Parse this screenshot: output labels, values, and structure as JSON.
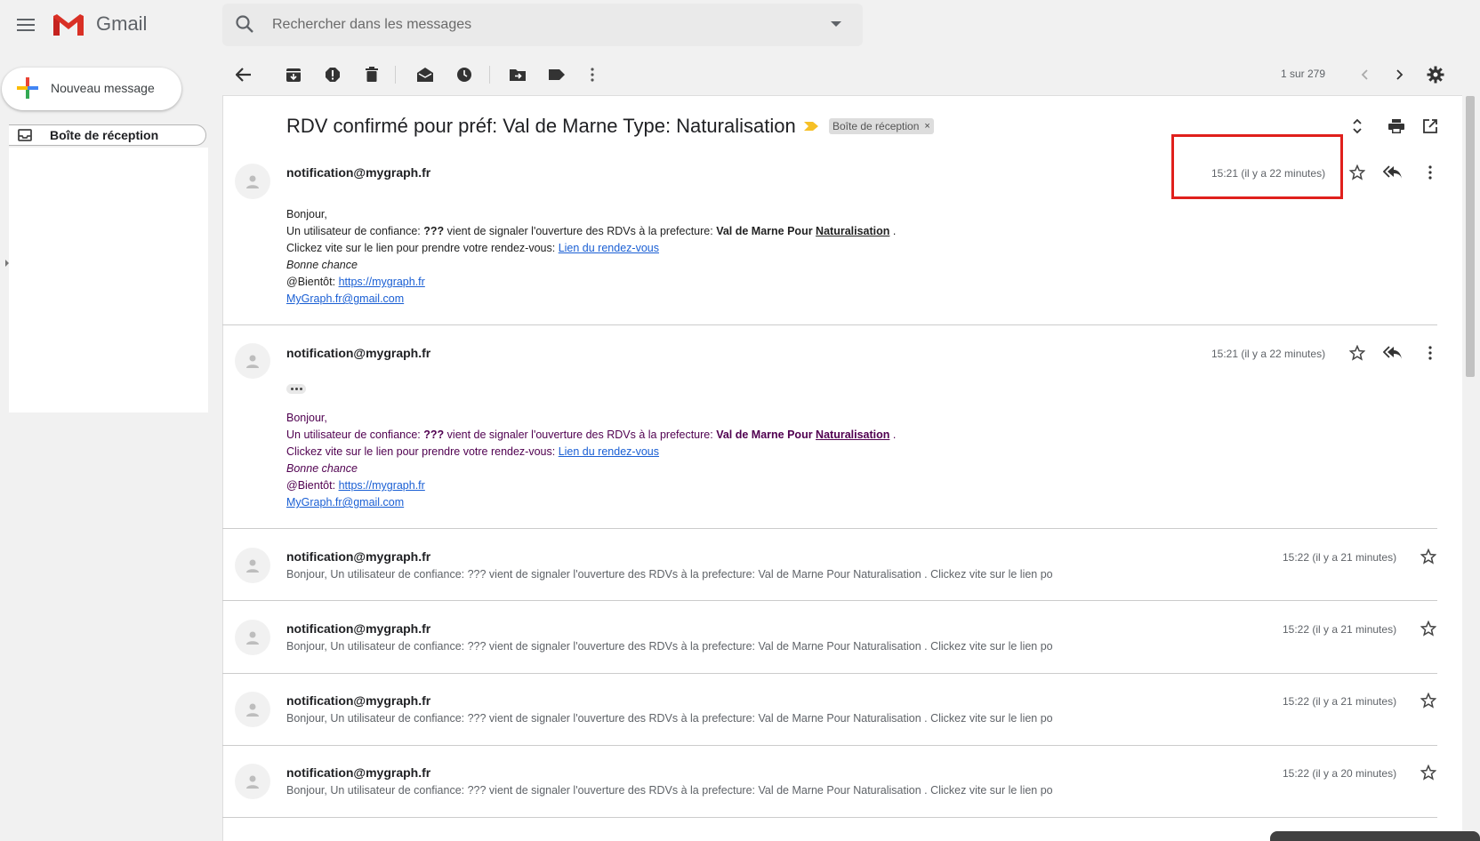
{
  "app": {
    "name": "Gmail",
    "menu_icon": "hamburger-menu-icon",
    "logo_icon": "gmail-m-logo"
  },
  "search": {
    "placeholder": "Rechercher dans les messages",
    "icon": "search-icon",
    "options_icon": "caret-down-icon"
  },
  "sidebar": {
    "compose_label": "Nouveau message",
    "inbox_label": "Boîte de réception"
  },
  "toolbar": {
    "pager": "1 sur 279",
    "icons": [
      "back-arrow-icon",
      "archive-icon",
      "report-spam-icon",
      "delete-icon",
      "mark-unread-icon",
      "snooze-icon",
      "move-to-icon",
      "label-icon",
      "more-vertical-icon",
      "older-chevron-icon",
      "newer-chevron-icon",
      "settings-gear-icon"
    ]
  },
  "thread": {
    "subject": "RDV confirmé pour préf: Val de Marne Type: Naturalisation",
    "label_chip": "Boîte de réception",
    "label_chip_close": "×"
  },
  "messages_expanded": [
    {
      "sender": "notification@mygraph.fr",
      "time": "15:21 (il y a 22 minutes)",
      "greeting": "Bonjour,",
      "line1_prefix": "Un utilisateur de confiance: ",
      "line1_bold1": "???",
      "line1_mid": " vient de signaler l'ouverture des RDVs à la prefecture: ",
      "line1_bold2": "Val de Marne Pour ",
      "line1_bold3": "Naturalisation",
      "line1_end": " .",
      "line2_prefix": "Clickez vite sur le lien pour prendre votre rendez-vous: ",
      "line2_link": "Lien du rendez-vous",
      "line3": "Bonne chance",
      "line4_prefix": "@Bientôt: ",
      "line4_link": "https://mygraph.fr",
      "line5_link": "MyGraph.fr@gmail.com"
    },
    {
      "sender": "notification@mygraph.fr",
      "time": "15:21 (il y a 22 minutes)",
      "greeting": "Bonjour,",
      "line1_prefix": "Un utilisateur de confiance: ",
      "line1_bold1": "???",
      "line1_mid": " vient de signaler l'ouverture des RDVs à la prefecture: ",
      "line1_bold2": "Val de Marne Pour ",
      "line1_bold3": "Naturalisation",
      "line1_end": " .",
      "line2_prefix": "Clickez vite sur le lien pour prendre votre rendez-vous: ",
      "line2_link": "Lien du rendez-vous",
      "line3": "Bonne chance",
      "line4_prefix": "@Bientôt: ",
      "line4_link": "https://mygraph.fr",
      "line5_link": "MyGraph.fr@gmail.com"
    }
  ],
  "messages_collapsed": [
    {
      "sender": "notification@mygraph.fr",
      "time": "15:22 (il y a 21 minutes)",
      "snippet": "Bonjour, Un utilisateur de confiance: ??? vient de signaler l'ouverture des RDVs à la prefecture: Val de Marne Pour Naturalisation . Clickez vite sur le lien po"
    },
    {
      "sender": "notification@mygraph.fr",
      "time": "15:22 (il y a 21 minutes)",
      "snippet": "Bonjour, Un utilisateur de confiance: ??? vient de signaler l'ouverture des RDVs à la prefecture: Val de Marne Pour Naturalisation . Clickez vite sur le lien po"
    },
    {
      "sender": "notification@mygraph.fr",
      "time": "15:22 (il y a 21 minutes)",
      "snippet": "Bonjour, Un utilisateur de confiance: ??? vient de signaler l'ouverture des RDVs à la prefecture: Val de Marne Pour Naturalisation . Clickez vite sur le lien po"
    },
    {
      "sender": "notification@mygraph.fr",
      "time": "15:22 (il y a 20 minutes)",
      "snippet": "Bonjour, Un utilisateur de confiance: ??? vient de signaler l'ouverture des RDVs à la prefecture: Val de Marne Pour Naturalisation . Clickez vite sur le lien po"
    }
  ],
  "colors": {
    "highlight_box": "#e0201c",
    "link": "#1a5fd4",
    "quoted_text": "#500050",
    "importance_marker": "#f6c026"
  }
}
